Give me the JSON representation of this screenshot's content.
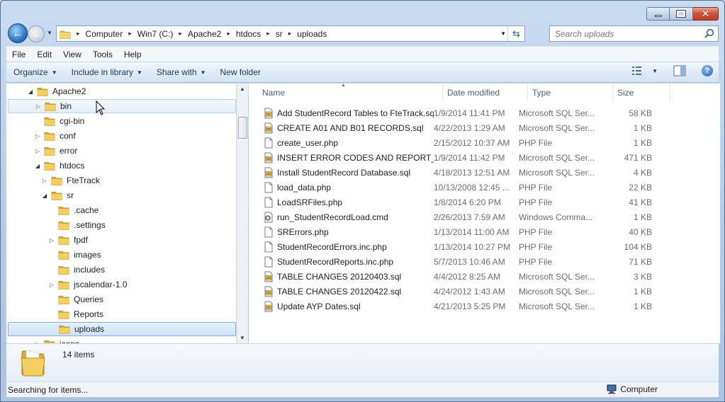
{
  "window": {
    "caption": {
      "minimize_glyph": "–",
      "maximize_glyph": "□",
      "close_glyph": "✕"
    }
  },
  "nav": {
    "back_icon": "back-arrow-icon",
    "forward_icon": "forward-arrow-icon",
    "breadcrumb": [
      "Computer",
      "Win7 (C:)",
      "Apache2",
      "htdocs",
      "sr",
      "uploads"
    ],
    "search_placeholder": "Search uploads"
  },
  "menu": [
    "File",
    "Edit",
    "View",
    "Tools",
    "Help"
  ],
  "commands": {
    "organize": "Organize",
    "include_in_library": "Include in library",
    "share_with": "Share with",
    "new_folder": "New folder"
  },
  "tree": [
    {
      "label": "Apache2",
      "level": 0,
      "expander": "open"
    },
    {
      "label": "bin",
      "level": 1,
      "expander": "closed",
      "state": "hover"
    },
    {
      "label": "cgi-bin",
      "level": 1,
      "expander": "none"
    },
    {
      "label": "conf",
      "level": 1,
      "expander": "closed"
    },
    {
      "label": "error",
      "level": 1,
      "expander": "closed"
    },
    {
      "label": "htdocs",
      "level": 1,
      "expander": "open"
    },
    {
      "label": "FteTrack",
      "level": 2,
      "expander": "closed"
    },
    {
      "label": "sr",
      "level": 2,
      "expander": "open"
    },
    {
      "label": ".cache",
      "level": 3,
      "expander": "none"
    },
    {
      "label": ".settings",
      "level": 3,
      "expander": "none"
    },
    {
      "label": "fpdf",
      "level": 3,
      "expander": "closed"
    },
    {
      "label": "images",
      "level": 3,
      "expander": "none"
    },
    {
      "label": "includes",
      "level": 3,
      "expander": "none"
    },
    {
      "label": "jscalendar-1.0",
      "level": 3,
      "expander": "closed"
    },
    {
      "label": "Queries",
      "level": 3,
      "expander": "none"
    },
    {
      "label": "Reports",
      "level": 3,
      "expander": "none"
    },
    {
      "label": "uploads",
      "level": 3,
      "expander": "none",
      "state": "selected"
    },
    {
      "label": "icons",
      "level": 1,
      "expander": "closed"
    }
  ],
  "columns": {
    "name": "Name",
    "date": "Date modified",
    "type": "Type",
    "size": "Size"
  },
  "files": [
    {
      "name": "Add StudentRecord Tables to FteTrack.sql",
      "date": "1/9/2014 11:41 PM",
      "type": "Microsoft SQL Ser...",
      "size": "58 KB",
      "icon": "sql-file-icon"
    },
    {
      "name": "CREATE A01 AND B01 RECORDS.sql",
      "date": "4/22/2013 1:29 AM",
      "type": "Microsoft SQL Ser...",
      "size": "1 KB",
      "icon": "sql-file-icon"
    },
    {
      "name": "create_user.php",
      "date": "2/15/2012 10:37 AM",
      "type": "PHP File",
      "size": "1 KB",
      "icon": "php-file-icon"
    },
    {
      "name": "INSERT ERROR CODES AND REPORT_CA...",
      "date": "1/9/2014 11:42 PM",
      "type": "Microsoft SQL Ser...",
      "size": "471 KB",
      "icon": "sql-file-icon"
    },
    {
      "name": "Install StudentRecord Database.sql",
      "date": "4/18/2013 12:51 AM",
      "type": "Microsoft SQL Ser...",
      "size": "4 KB",
      "icon": "sql-file-icon"
    },
    {
      "name": "load_data.php",
      "date": "10/13/2008 12:45 ...",
      "type": "PHP File",
      "size": "22 KB",
      "icon": "php-file-icon"
    },
    {
      "name": "LoadSRFiles.php",
      "date": "1/8/2014 6:20 PM",
      "type": "PHP File",
      "size": "41 KB",
      "icon": "php-file-icon"
    },
    {
      "name": "run_StudentRecordLoad.cmd",
      "date": "2/26/2013 7:59 AM",
      "type": "Windows Comma...",
      "size": "1 KB",
      "icon": "cmd-file-icon"
    },
    {
      "name": "SRErrors.php",
      "date": "1/13/2014 11:00 AM",
      "type": "PHP File",
      "size": "40 KB",
      "icon": "php-file-icon"
    },
    {
      "name": "StudentRecordErrors.inc.php",
      "date": "1/13/2014 10:27 PM",
      "type": "PHP File",
      "size": "104 KB",
      "icon": "php-file-icon"
    },
    {
      "name": "StudentRecordReports.inc.php",
      "date": "5/7/2013 10:46 AM",
      "type": "PHP File",
      "size": "71 KB",
      "icon": "php-file-icon"
    },
    {
      "name": "TABLE CHANGES 20120403.sql",
      "date": "4/4/2012 8:25 AM",
      "type": "Microsoft SQL Ser...",
      "size": "3 KB",
      "icon": "sql-file-icon"
    },
    {
      "name": "TABLE CHANGES 20120422.sql",
      "date": "4/24/2012 1:43 AM",
      "type": "Microsoft SQL Ser...",
      "size": "1 KB",
      "icon": "sql-file-icon"
    },
    {
      "name": "Update AYP Dates.sql",
      "date": "4/21/2013 5:25 PM",
      "type": "Microsoft SQL Ser...",
      "size": "1 KB",
      "icon": "sql-file-icon"
    }
  ],
  "details": {
    "item_count": "14 items"
  },
  "status": {
    "text": "Searching for items...",
    "zone": "Computer"
  },
  "colors": {
    "folder": "#e9c14a",
    "selection": "#cfe3f7",
    "accent": "#1e395b"
  }
}
